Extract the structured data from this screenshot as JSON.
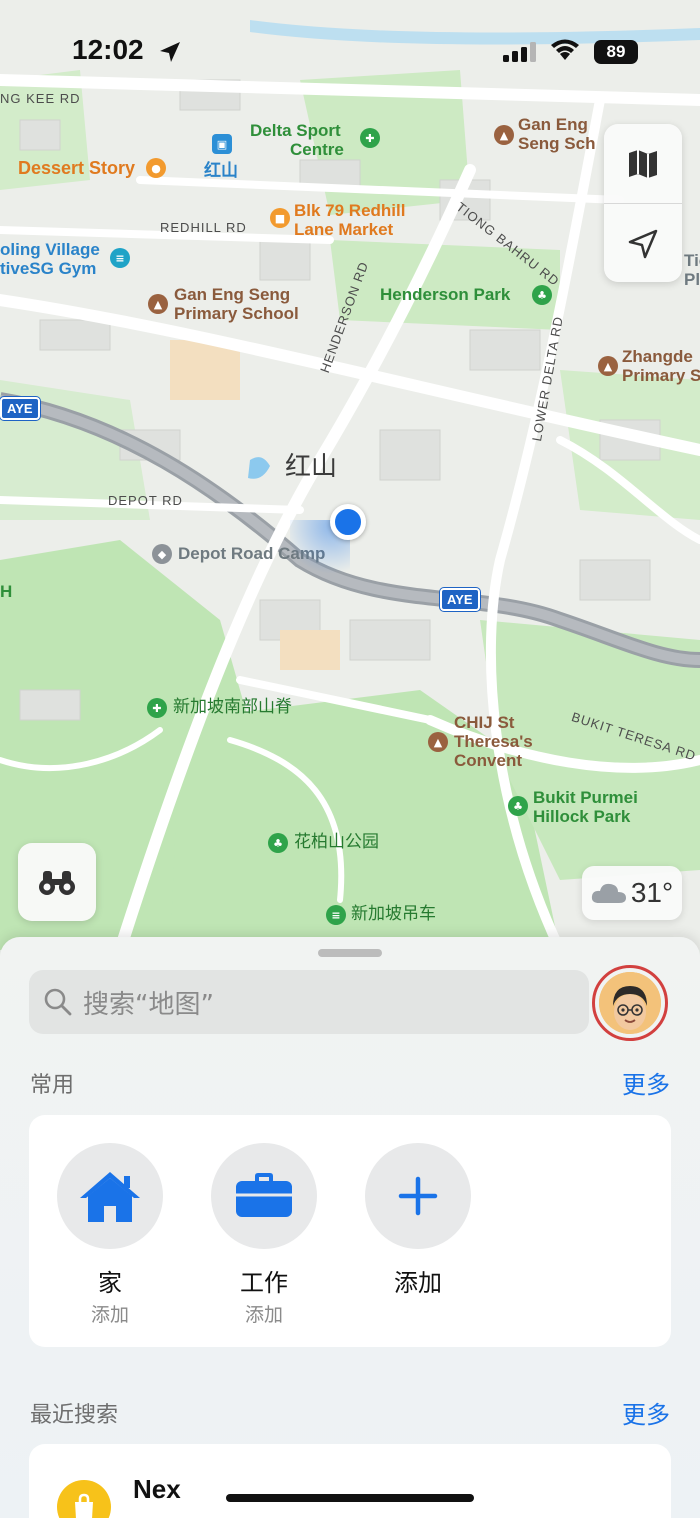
{
  "status_bar": {
    "time": "12:02",
    "battery": "89"
  },
  "map": {
    "area_label": "红山",
    "pois": {
      "dessert_story": "Dessert Story",
      "delta_sport_1": "Delta Sport",
      "delta_sport_2": "Centre",
      "gan_eng_seng_sch_1": "Gan Eng",
      "gan_eng_seng_sch_2": "Seng Sch",
      "hongshan_station": "红山",
      "blk79_1": "Blk 79 Redhill",
      "blk79_2": "Lane Market",
      "bling_village_1": "oling Village",
      "bling_village_2": "tiveSG Gym",
      "gan_eng_seng_primary_1": "Gan Eng Seng",
      "gan_eng_seng_primary_2": "Primary School",
      "henderson_park": "Henderson Park",
      "zhangde_1": "Zhangde",
      "zhangde_2": "Primary S",
      "tio_1": "Tio",
      "tio_2": "Pla",
      "depot_road_camp": "Depot Road Camp",
      "sg_southern_ridges": "新加坡南部山脊",
      "chij_1": "CHIJ St",
      "chij_2": "Theresa's",
      "chij_3": "Convent",
      "bukit_purmei_1": "Bukit Purmei",
      "bukit_purmei_2": "Hillock Park",
      "mount_faber_park": "花柏山公园",
      "sg_cable_car": "新加坡吊车",
      "h_edge": "H"
    },
    "roads": {
      "kee_rd": "NG KEE RD",
      "redhill_rd": "REDHILL RD",
      "depot_rd": "DEPOT RD",
      "henderson_rd": "HENDERSON RD",
      "tiong_bahru_rd": "TIONG BAHRU RD",
      "lower_delta_rd": "LOWER DELTA RD",
      "bukit_teresa_rd": "BUKIT TERESA RD"
    },
    "shields": {
      "aye_left": "AYE",
      "aye_main": "AYE"
    },
    "weather": {
      "temperature": "31°",
      "icon": "cloud-icon"
    }
  },
  "sheet": {
    "search_placeholder": "搜索“地图”",
    "favorites": {
      "title": "常用",
      "more": "更多",
      "items": [
        {
          "name": "家",
          "sub": "添加",
          "icon": "home-icon"
        },
        {
          "name": "工作",
          "sub": "添加",
          "icon": "briefcase-icon"
        },
        {
          "name": "添加",
          "sub": "",
          "icon": "plus-icon"
        }
      ]
    },
    "recents": {
      "title": "最近搜索",
      "more": "更多",
      "items": [
        {
          "name": "Nex",
          "icon": "shopping-bag-icon"
        }
      ]
    }
  },
  "colors": {
    "accent": "#1a73e8",
    "avatar_ring": "#d2403f",
    "park_green": "#b9e3b0"
  }
}
